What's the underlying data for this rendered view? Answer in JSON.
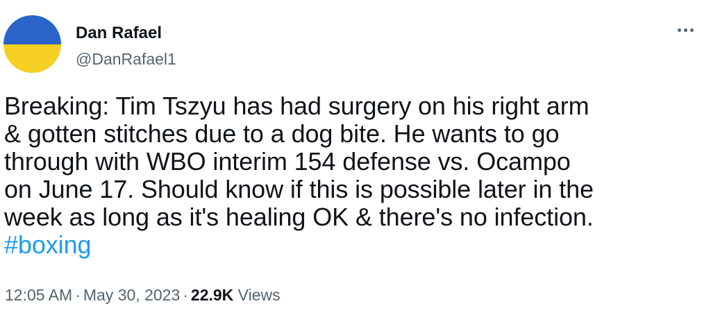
{
  "author": {
    "name": "Dan Rafael",
    "handle": "@DanRafael1",
    "avatar_colors": {
      "top": "#2a64c8",
      "bottom": "#f5d023"
    }
  },
  "menu": {
    "icon": "more-horizontal-icon"
  },
  "tweet": {
    "lines": [
      "Breaking: Tim Tszyu has had surgery on his right arm",
      "& gotten stitches due to a dog bite. He wants to go",
      "through with WBO interim 154 defense vs. Ocampo",
      "on June 17. Should know if this is possible later in the",
      "week as long as it's healing OK & there's no infection."
    ],
    "hashtag": "#boxing"
  },
  "meta": {
    "time": "12:05 AM",
    "date": "May 30, 2023",
    "separator": "·",
    "views_count": "22.9K",
    "views_label": "Views"
  },
  "colors": {
    "text": "#0f1419",
    "secondary": "#536471",
    "link": "#1d9bf0"
  }
}
